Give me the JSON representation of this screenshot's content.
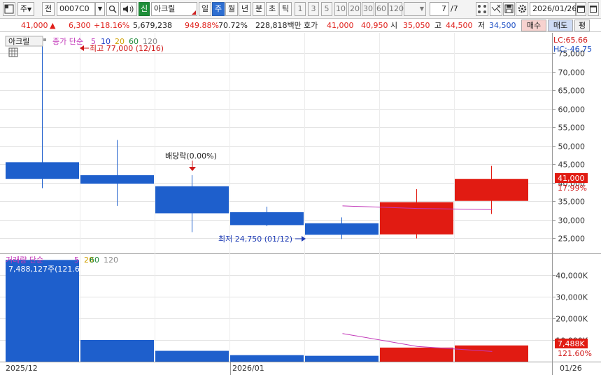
{
  "toolbar": {
    "type_label": "주",
    "prev_label": "전",
    "code_value": "0007C0",
    "credit_label": "신",
    "name_value": "아크릴",
    "period_day": "일",
    "period_week": "주",
    "period_month": "월",
    "period_year": "년",
    "period_min": "분",
    "period_sec": "초",
    "period_tick": "틱",
    "intervals": [
      "1",
      "3",
      "5",
      "10",
      "20",
      "30",
      "60",
      "120"
    ],
    "count_value": "7",
    "count_total": "/7",
    "date_value": "2026/01/26"
  },
  "quote": {
    "price": "41,000",
    "change_arrow": "▲",
    "change": "6,300",
    "change_pct": "+18.16%",
    "volume": "5,679,238",
    "turnover_pct": "949.88%",
    "ratio": "70.72%",
    "amount": "228,818백만",
    "hoga_label": "호가",
    "ask": "41,000",
    "bid": "40,950",
    "open_label": "시",
    "open": "35,050",
    "high_label": "고",
    "high": "44,500",
    "low_label": "저",
    "low": "34,500",
    "buy_label": "매수",
    "sell_label": "매도",
    "eval_label": "평"
  },
  "price_panel": {
    "stock_tag": "아크릴",
    "legend_type": "종가 단순",
    "ma": [
      "5",
      "10",
      "20",
      "60",
      "120"
    ],
    "ma_colors": [
      "#c238b9",
      "#2040c8",
      "#d0a000",
      "#1f8a3a",
      "#888888"
    ],
    "max_label": "최고 77,000 (12/16)",
    "min_label": "최저 24,750 (01/12)",
    "dividend_label": "배당락(0.00%)",
    "lc": "LC:65.66",
    "hc": "HC:-46.75",
    "last_price": "41,000",
    "last_pct": "17.99%"
  },
  "volume_panel": {
    "legend_type": "거래량 단순",
    "ma": [
      "5",
      "20",
      "60",
      "120"
    ],
    "ma_colors": [
      "#c238b9",
      "#d0a000",
      "#1f8a3a",
      "#888888"
    ],
    "max_label": "7,488,127주(121.60%)",
    "last_volume": "7,488K",
    "last_pct": "121.60%"
  },
  "x_axis": {
    "labels": [
      "2025/12",
      "2026/01"
    ],
    "last_date": "01/26"
  },
  "chart_data": {
    "type": "candlestick",
    "price_axis": {
      "min": 25000,
      "max": 75000,
      "step": 5000
    },
    "volume_axis": {
      "ticks": [
        "10,000K",
        "20,000K",
        "30,000K",
        "40,000K"
      ],
      "max_k": 40000
    },
    "candles": [
      {
        "open": 41000,
        "high": 77000,
        "low": 38500,
        "close": 45500,
        "volume_k": 47000,
        "color": "blue"
      },
      {
        "open": 42000,
        "high": 51500,
        "low": 33700,
        "close": 39700,
        "volume_k": 10000,
        "color": "blue"
      },
      {
        "open": 39000,
        "high": 42000,
        "low": 26600,
        "close": 31700,
        "volume_k": 5000,
        "color": "blue"
      },
      {
        "open": 32000,
        "high": 33500,
        "low": 28200,
        "close": 28500,
        "volume_k": 3000,
        "color": "blue"
      },
      {
        "open": 29000,
        "high": 30600,
        "low": 24750,
        "close": 25900,
        "volume_k": 2700,
        "color": "blue"
      },
      {
        "open": 26000,
        "high": 38200,
        "low": 24900,
        "close": 34700,
        "volume_k": 6500,
        "color": "red"
      },
      {
        "open": 35050,
        "high": 44500,
        "low": 31500,
        "close": 41000,
        "volume_k": 7488,
        "color": "red"
      }
    ],
    "ma5_price": [
      {
        "i": 4.5,
        "v": 33700
      },
      {
        "i": 5.5,
        "v": 33000
      },
      {
        "i": 6.5,
        "v": 32700
      }
    ],
    "ma5_volume_k": [
      {
        "i": 4.5,
        "v": 13000
      },
      {
        "i": 5.5,
        "v": 7000
      },
      {
        "i": 6.5,
        "v": 4700
      }
    ]
  }
}
